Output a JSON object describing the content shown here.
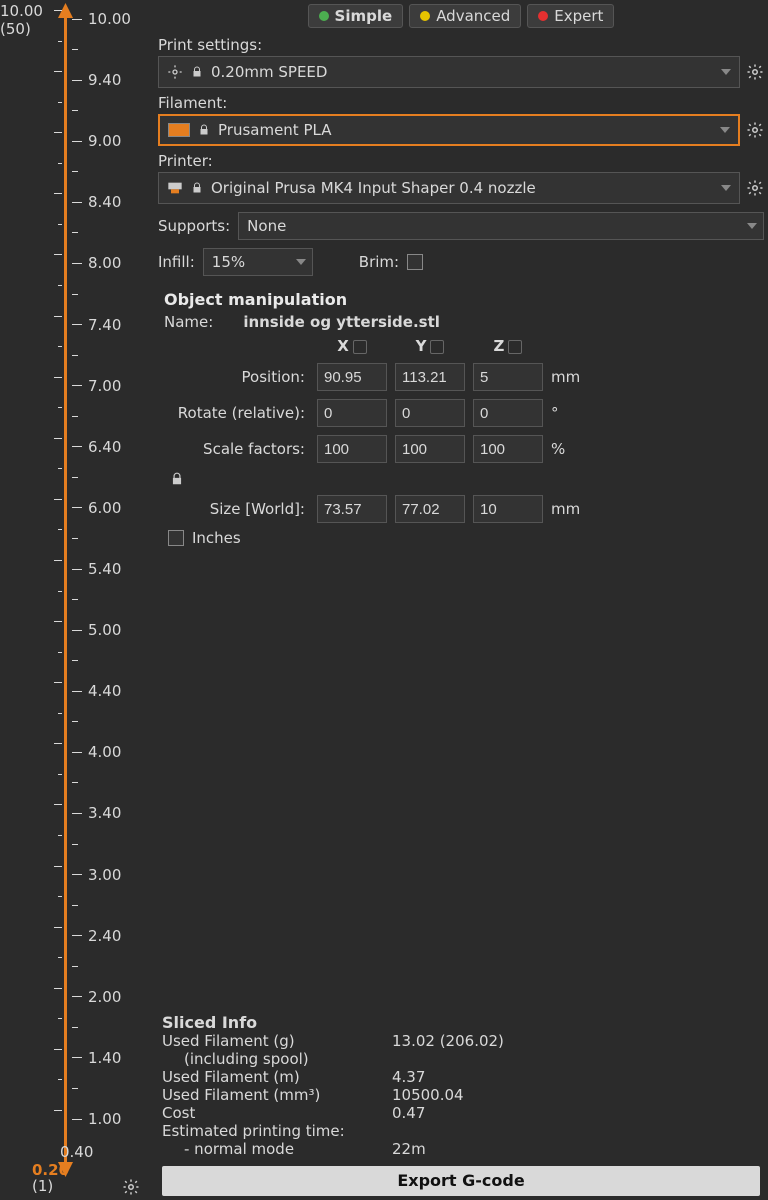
{
  "slider": {
    "top_value": "10.00",
    "top_count": "(50)",
    "bot_value": "0.20",
    "bot_count": "(1)",
    "bot_extra": "0.40",
    "major_ticks": [
      "10.00",
      "9.40",
      "9.00",
      "8.40",
      "8.00",
      "7.40",
      "7.00",
      "6.40",
      "6.00",
      "5.40",
      "5.00",
      "4.40",
      "4.00",
      "3.40",
      "3.00",
      "2.40",
      "2.00",
      "1.40",
      "1.00"
    ]
  },
  "modes": {
    "simple": "Simple",
    "advanced": "Advanced",
    "expert": "Expert"
  },
  "labels": {
    "print_settings": "Print settings:",
    "filament": "Filament:",
    "printer": "Printer:",
    "supports": "Supports:",
    "infill": "Infill:",
    "brim": "Brim:"
  },
  "dropdowns": {
    "print_settings": "0.20mm SPEED",
    "filament": "Prusament PLA",
    "printer": "Original Prusa MK4 Input Shaper 0.4 nozzle",
    "supports": "None",
    "infill": "15%"
  },
  "object_manip": {
    "title": "Object manipulation",
    "name_label": "Name:",
    "name_value": "innside og ytterside.stl",
    "axes": {
      "x": "X",
      "y": "Y",
      "z": "Z"
    },
    "rows": {
      "position": {
        "label": "Position:",
        "x": "90.95",
        "y": "113.21",
        "z": "5",
        "unit": "mm"
      },
      "rotate": {
        "label": "Rotate (relative):",
        "x": "0",
        "y": "0",
        "z": "0",
        "unit": "°"
      },
      "scale": {
        "label": "Scale factors:",
        "x": "100",
        "y": "100",
        "z": "100",
        "unit": "%"
      },
      "size": {
        "label": "Size [World]:",
        "x": "73.57",
        "y": "77.02",
        "z": "10",
        "unit": "mm"
      }
    },
    "inches_label": "Inches"
  },
  "sliced": {
    "title": "Sliced Info",
    "rows": {
      "fg": {
        "k": "Used Filament (g)",
        "sub": "(including spool)",
        "v": "13.02 (206.02)"
      },
      "fm": {
        "k": "Used Filament (m)",
        "v": "4.37"
      },
      "fmm": {
        "k": "Used Filament (mm³)",
        "v": "10500.04"
      },
      "cost": {
        "k": "Cost",
        "v": "0.47"
      },
      "time": {
        "k": "Estimated printing time:",
        "sub": "- normal mode",
        "v": "22m"
      }
    }
  },
  "export_label": "Export G-code"
}
